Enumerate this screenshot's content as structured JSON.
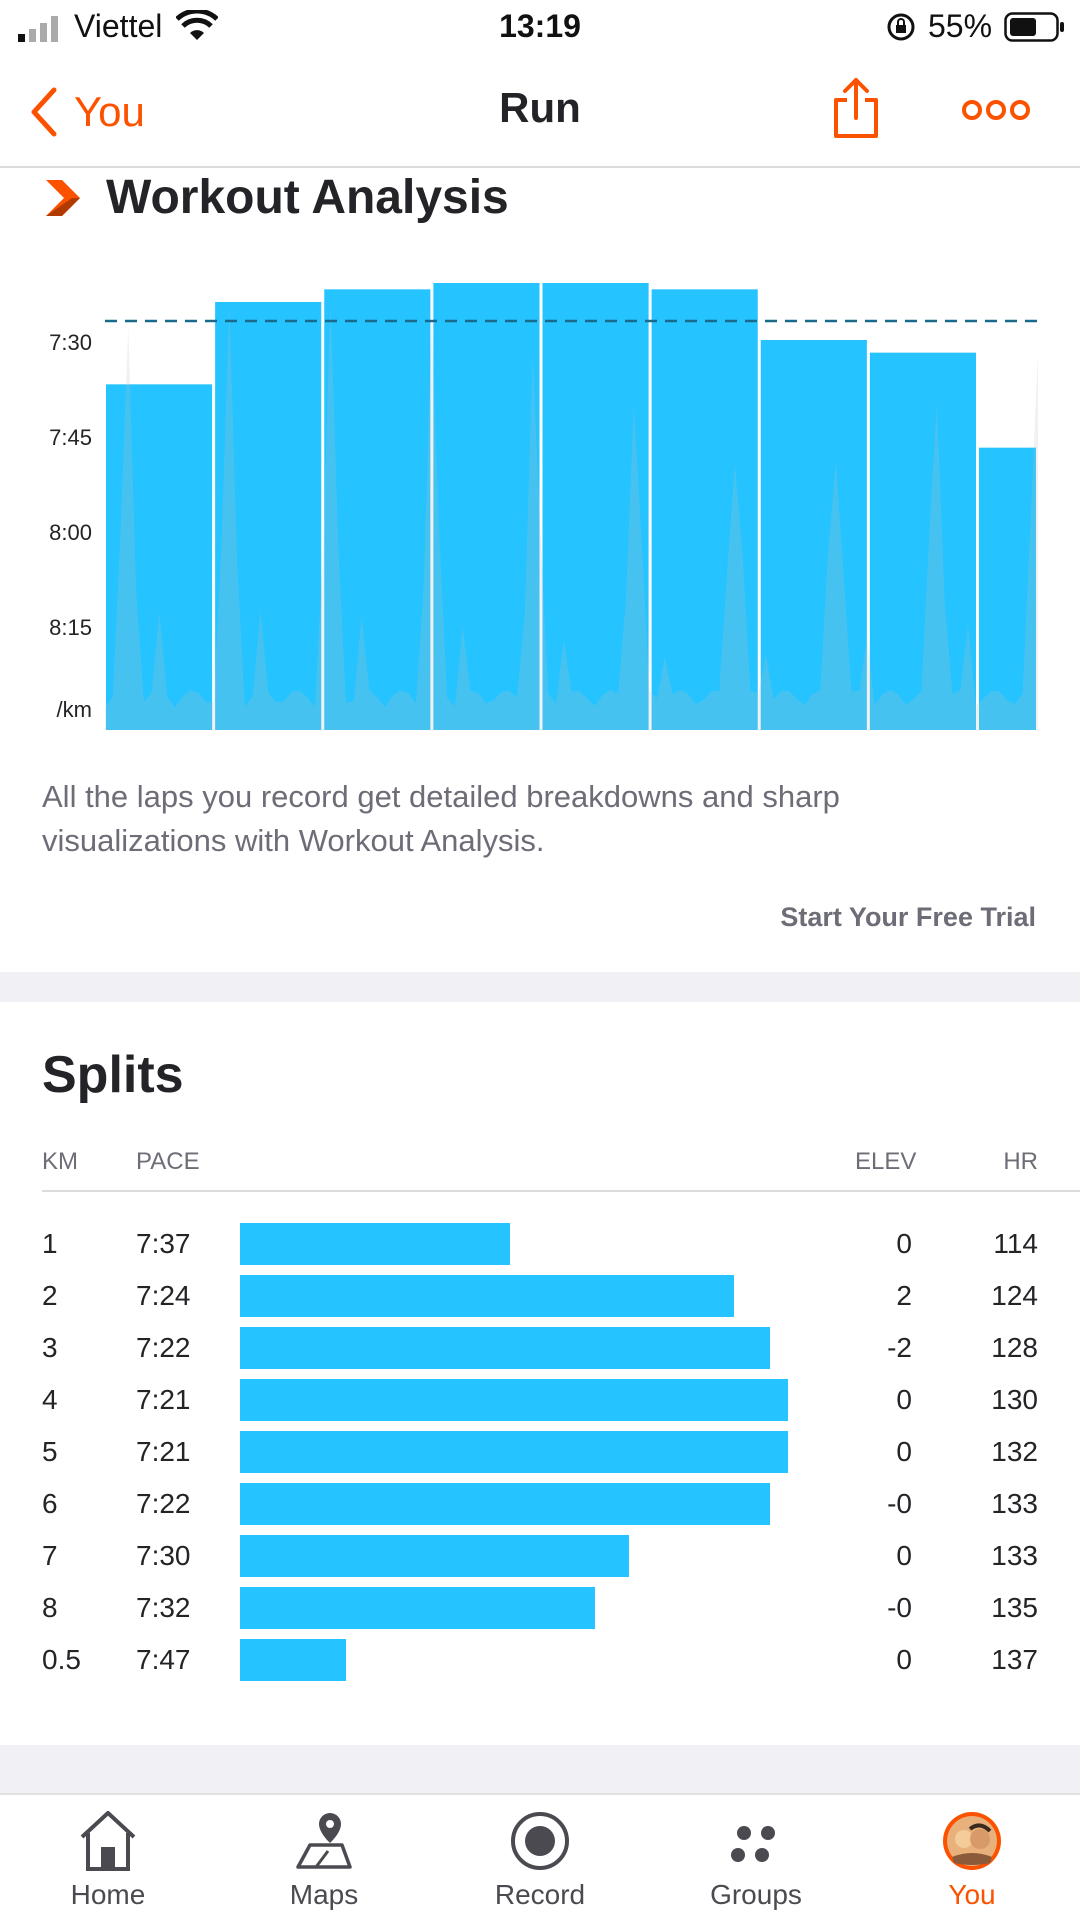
{
  "status_bar": {
    "carrier": "Viettel",
    "time": "13:19",
    "battery": "55%"
  },
  "nav": {
    "back_label": "You",
    "title": "Run"
  },
  "workout_analysis": {
    "title": "Workout Analysis",
    "description": "All the laps you record get detailed breakdowns and sharp visualizations with Workout Analysis.",
    "cta": "Start Your Free Trial"
  },
  "chart_data": {
    "type": "bar",
    "ylabel": "/km",
    "y_ticks": [
      "7:30",
      "7:45",
      "8:00",
      "8:15"
    ],
    "y_axis": "pace (min/km), faster at top",
    "average_line": "dashed, ~7:27 /km",
    "categories": [
      "1",
      "2",
      "3",
      "4",
      "5",
      "6",
      "7",
      "8",
      "0.5"
    ],
    "values": [
      "7:37",
      "7:24",
      "7:22",
      "7:21",
      "7:21",
      "7:22",
      "7:30",
      "7:32",
      "7:47"
    ],
    "colors": {
      "bar": "#25c3ff",
      "average_line": "#1a6a8c",
      "background_series": "#bfbfbf"
    }
  },
  "splits": {
    "title": "Splits",
    "headers": {
      "km": "KM",
      "pace": "PACE",
      "elev": "ELEV",
      "hr": "HR"
    },
    "rows": [
      {
        "km": "1",
        "pace": "7:37",
        "elev": "0",
        "hr": "114"
      },
      {
        "km": "2",
        "pace": "7:24",
        "elev": "2",
        "hr": "124"
      },
      {
        "km": "3",
        "pace": "7:22",
        "elev": "-2",
        "hr": "128"
      },
      {
        "km": "4",
        "pace": "7:21",
        "elev": "0",
        "hr": "130"
      },
      {
        "km": "5",
        "pace": "7:21",
        "elev": "0",
        "hr": "132"
      },
      {
        "km": "6",
        "pace": "7:22",
        "elev": "-0",
        "hr": "133"
      },
      {
        "km": "7",
        "pace": "7:30",
        "elev": "0",
        "hr": "133"
      },
      {
        "km": "8",
        "pace": "7:32",
        "elev": "-0",
        "hr": "135"
      },
      {
        "km": "0.5",
        "pace": "7:47",
        "elev": "0",
        "hr": "137"
      }
    ]
  },
  "tabs": [
    {
      "label": "Home",
      "icon": "home-icon",
      "active": false
    },
    {
      "label": "Maps",
      "icon": "maps-icon",
      "active": false
    },
    {
      "label": "Record",
      "icon": "record-icon",
      "active": false
    },
    {
      "label": "Groups",
      "icon": "groups-icon",
      "active": false
    },
    {
      "label": "You",
      "icon": "avatar",
      "active": true
    }
  ],
  "colors": {
    "accent": "#fc5200",
    "bar": "#25c3ff",
    "text": "#242428",
    "muted": "#6d6d78"
  }
}
